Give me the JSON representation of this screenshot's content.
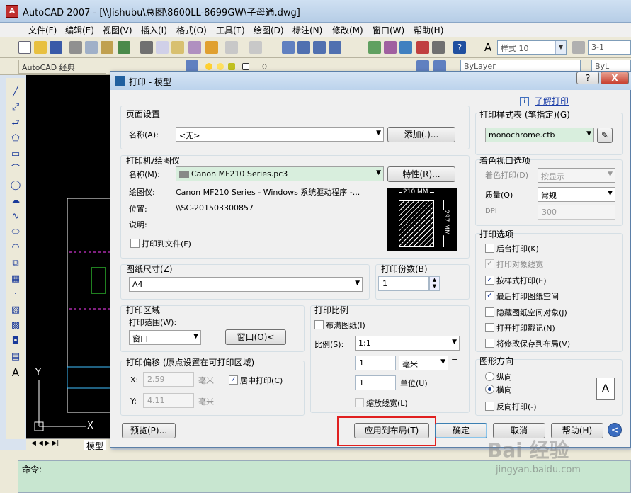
{
  "app": {
    "title": "AutoCAD 2007 - [\\\\Jishubu\\总图\\8600LL-8699GW\\子母通.dwg]",
    "icon_letter": "A"
  },
  "menu": [
    "文件(F)",
    "编辑(E)",
    "视图(V)",
    "插入(I)",
    "格式(O)",
    "工具(T)",
    "绘图(D)",
    "标注(N)",
    "修改(M)",
    "窗口(W)",
    "帮助(H)"
  ],
  "toolbar": {
    "style_combo": "样式 10",
    "style_combo2": "3-1",
    "workspace": "AutoCAD 经典",
    "layer_value": "0",
    "linetype": "ByLayer",
    "linetype2": "ByL"
  },
  "left_icons": [
    "line-icon",
    "polyline-icon",
    "construction-line-icon",
    "polygon-icon",
    "rectangle-icon",
    "arc-icon",
    "circle-icon",
    "revcloud-icon",
    "spline-icon",
    "ellipse-icon",
    "ellipse-arc-icon",
    "insert-block-icon",
    "make-block-icon",
    "point-icon",
    "hatch-icon",
    "gradient-icon",
    "region-icon",
    "table-icon",
    "text-icon"
  ],
  "left_text_icon": "A",
  "drawing": {
    "axis_y": "Y",
    "axis_x": "X"
  },
  "model_tab": "模型",
  "command": {
    "prompt": "命令:"
  },
  "dialog": {
    "title": "打印 - 模型",
    "help_btn": "?",
    "close_btn": "X",
    "learn_link": "了解打印",
    "info_icon": "i",
    "page_setup": {
      "label": "页面设置",
      "name_label": "名称(A):",
      "name_value": "<无>",
      "add_btn": "添加(.)..."
    },
    "printer": {
      "label": "打印机/绘图仪",
      "name_label": "名称(M):",
      "name_value": "Canon MF210 Series.pc3",
      "props_btn": "特性(R)...",
      "plotter_label": "绘图仪:",
      "plotter_value": "Canon MF210 Series - Windows 系统驱动程序 -...",
      "where_label": "位置:",
      "where_value": "\\\\SC-201503300857",
      "desc_label": "说明:",
      "to_file": "打印到文件(F)",
      "width_mm": "210 MM",
      "height_mm": "297 MM"
    },
    "paper": {
      "label": "图纸尺寸(Z)",
      "value": "A4"
    },
    "copies": {
      "label": "打印份数(B)",
      "value": "1"
    },
    "area": {
      "label": "打印区域",
      "range_label": "打印范围(W):",
      "range_value": "窗口",
      "window_btn": "窗口(O)<"
    },
    "scale": {
      "label": "打印比例",
      "fit": "布满图纸(I)",
      "scale_label": "比例(S):",
      "scale_value": "1:1",
      "val1": "1",
      "unit": "毫米",
      "eq": "=",
      "val2": "1",
      "unit_label": "单位(U)",
      "lineweights": "缩放线宽(L)"
    },
    "offset": {
      "label": "打印偏移 (原点设置在可打印区域)",
      "x_label": "X:",
      "x_value": "2.59",
      "y_label": "Y:",
      "y_value": "4.11",
      "mm1": "毫米",
      "mm2": "毫米",
      "center": "居中打印(C)"
    },
    "style_table": {
      "label": "打印样式表 (笔指定)(G)",
      "value": "monochrome.ctb"
    },
    "shaded": {
      "label": "着色视口选项",
      "shade_label": "着色打印(D)",
      "shade_value": "按显示",
      "quality_label": "质量(Q)",
      "quality_value": "常规",
      "dpi_label": "DPI",
      "dpi_value": "300"
    },
    "options": {
      "label": "打印选项",
      "items": [
        {
          "text": "后台打印(K)",
          "checked": false,
          "disabled": false
        },
        {
          "text": "打印对象线宽",
          "checked": true,
          "disabled": true
        },
        {
          "text": "按样式打印(E)",
          "checked": true,
          "disabled": false
        },
        {
          "text": "最后打印图纸空间",
          "checked": true,
          "disabled": false
        },
        {
          "text": "隐藏图纸空间对象(J)",
          "checked": false,
          "disabled": false
        },
        {
          "text": "打开打印戳记(N)",
          "checked": false,
          "disabled": false
        },
        {
          "text": "将修改保存到布局(V)",
          "checked": false,
          "disabled": false
        }
      ]
    },
    "orientation": {
      "label": "图形方向",
      "portrait": "纵向",
      "landscape": "横向",
      "reverse": "反向打印(-)",
      "icon_letter": "A"
    },
    "buttons": {
      "preview": "预览(P)...",
      "apply": "应用到布局(T)",
      "ok": "确定",
      "cancel": "取消",
      "help": "帮助(H)",
      "more": "<"
    }
  },
  "colors": {
    "highlight": "#e02020",
    "accent": "#1d3f88"
  },
  "watermark": {
    "brand": "Bai 经验",
    "url": "jingyan.baidu.com"
  }
}
